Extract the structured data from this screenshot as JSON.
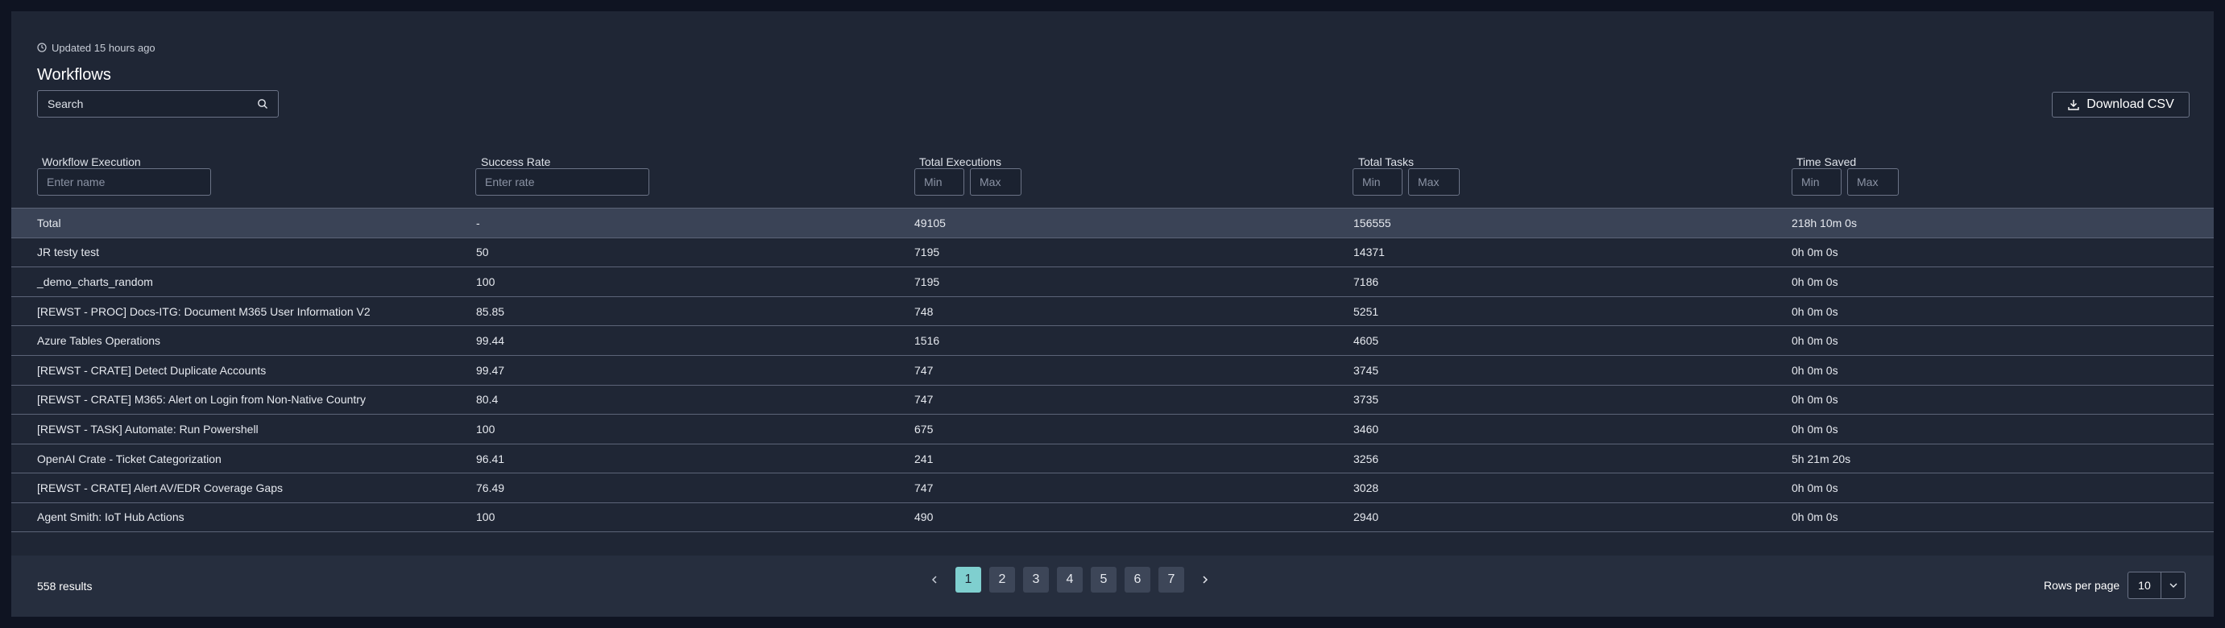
{
  "header": {
    "updated_text": "Updated 15 hours ago",
    "title": "Workflows"
  },
  "search": {
    "placeholder": "Search"
  },
  "toolbar": {
    "download_label": "Download CSV"
  },
  "columns": [
    {
      "label": "Workflow Execution",
      "filter_placeholder": "Enter name"
    },
    {
      "label": "Success Rate",
      "filter_placeholder": "Enter rate"
    },
    {
      "label": "Total Executions",
      "min_placeholder": "Min",
      "max_placeholder": "Max"
    },
    {
      "label": "Total Tasks",
      "min_placeholder": "Min",
      "max_placeholder": "Max"
    },
    {
      "label": "Time Saved",
      "min_placeholder": "Min",
      "max_placeholder": "Max"
    }
  ],
  "rows": [
    [
      "Total",
      "-",
      "49105",
      "156555",
      "218h 10m 0s"
    ],
    [
      "JR testy test",
      "50",
      "7195",
      "14371",
      "0h 0m 0s"
    ],
    [
      "_demo_charts_random",
      "100",
      "7195",
      "7186",
      "0h 0m 0s"
    ],
    [
      "[REWST - PROC] Docs-ITG: Document M365 User Information V2",
      "85.85",
      "748",
      "5251",
      "0h 0m 0s"
    ],
    [
      "Azure Tables Operations",
      "99.44",
      "1516",
      "4605",
      "0h 0m 0s"
    ],
    [
      "[REWST - CRATE] Detect Duplicate Accounts",
      "99.47",
      "747",
      "3745",
      "0h 0m 0s"
    ],
    [
      "[REWST - CRATE] M365: Alert on Login from Non-Native Country",
      "80.4",
      "747",
      "3735",
      "0h 0m 0s"
    ],
    [
      "[REWST - TASK] Automate: Run Powershell",
      "100",
      "675",
      "3460",
      "0h 0m 0s"
    ],
    [
      "OpenAI Crate - Ticket Categorization",
      "96.41",
      "241",
      "3256",
      "5h 21m 20s"
    ],
    [
      "[REWST - CRATE] Alert AV/EDR Coverage Gaps",
      "76.49",
      "747",
      "3028",
      "0h 0m 0s"
    ],
    [
      "Agent Smith: IoT Hub Actions",
      "100",
      "490",
      "2940",
      "0h 0m 0s"
    ]
  ],
  "footer": {
    "results_text": "558 results",
    "pages": [
      "1",
      "2",
      "3",
      "4",
      "5",
      "6",
      "7"
    ],
    "current_page": "1",
    "rows_per_page_label": "Rows per page",
    "rows_per_page_value": "10"
  },
  "icons": {
    "clock": "clock-icon",
    "search": "search-icon",
    "download": "download-icon",
    "prev": "chevron-left-icon",
    "next": "chevron-right-icon",
    "dropdown": "chevron-down-icon"
  },
  "colors": {
    "background": "#0f1422",
    "panel": "#1f2635",
    "total_row": "#3a4356",
    "active_page": "#7fcfcf"
  }
}
